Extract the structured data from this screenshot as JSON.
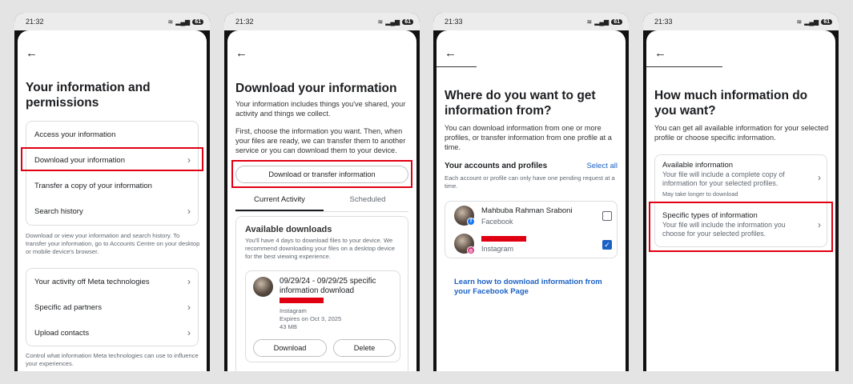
{
  "status": {
    "time1": "21:32",
    "time2": "21:32",
    "time3": "21:33",
    "time4": "21:33",
    "battery": "61"
  },
  "screen1": {
    "title": "Your information and permissions",
    "items": [
      "Access your information",
      "Download your information",
      "Transfer a copy of your information",
      "Search history"
    ],
    "note1": "Download or view your information and search history. To transfer your information, go to Accounts Centre on your desktop or mobile device's browser.",
    "items2": [
      "Your activity off Meta technologies",
      "Specific ad partners",
      "Upload contacts"
    ],
    "note2": "Control what information Meta technologies can use to influence your experiences."
  },
  "screen2": {
    "title": "Download your information",
    "desc1": "Your information includes things you've shared, your activity and things we collect.",
    "desc2": "First, choose the information you want. Then, when your files are ready, we can transfer them to another service or you can download them to your device.",
    "main_button": "Download or transfer information",
    "tabs": [
      "Current Activity",
      "Scheduled"
    ],
    "downloads_title": "Available downloads",
    "downloads_desc": "You'll have 4 days to download files to your device. We recommend downloading your files on a desktop device for the best viewing experience.",
    "file_title": "09/29/24 - 09/29/25 specific information download",
    "file_source": "Instagram",
    "file_expiry": "Expires on Oct 3, 2025",
    "file_size": "43 MB",
    "download_button": "Download",
    "delete_button": "Delete"
  },
  "screen3": {
    "title": "Where do you want to get information from?",
    "desc": "You can download information from one or more profiles, or transfer information from one profile at a time.",
    "section_title": "Your accounts and profiles",
    "select_all": "Select all",
    "section_note": "Each account or profile can only have one pending request at a time.",
    "accounts": [
      {
        "name": "Mahbuba Rahman Sraboni",
        "platform": "Facebook",
        "checked": false
      },
      {
        "name": "",
        "platform": "Instagram",
        "checked": true
      }
    ],
    "link": "Learn how to download information from your Facebook Page"
  },
  "screen4": {
    "title": "How much information do you want?",
    "desc": "You can get all available information for your selected profile or choose specific information.",
    "options": [
      {
        "title": "Available information",
        "desc": "Your file will include a complete copy of information for your selected profiles.",
        "note": "May take longer to download"
      },
      {
        "title": "Specific types of information",
        "desc": "Your file will include the information you choose for your selected profiles.",
        "note": ""
      }
    ]
  },
  "colors": {
    "highlight": "#e00012",
    "link": "#1b61c4"
  }
}
